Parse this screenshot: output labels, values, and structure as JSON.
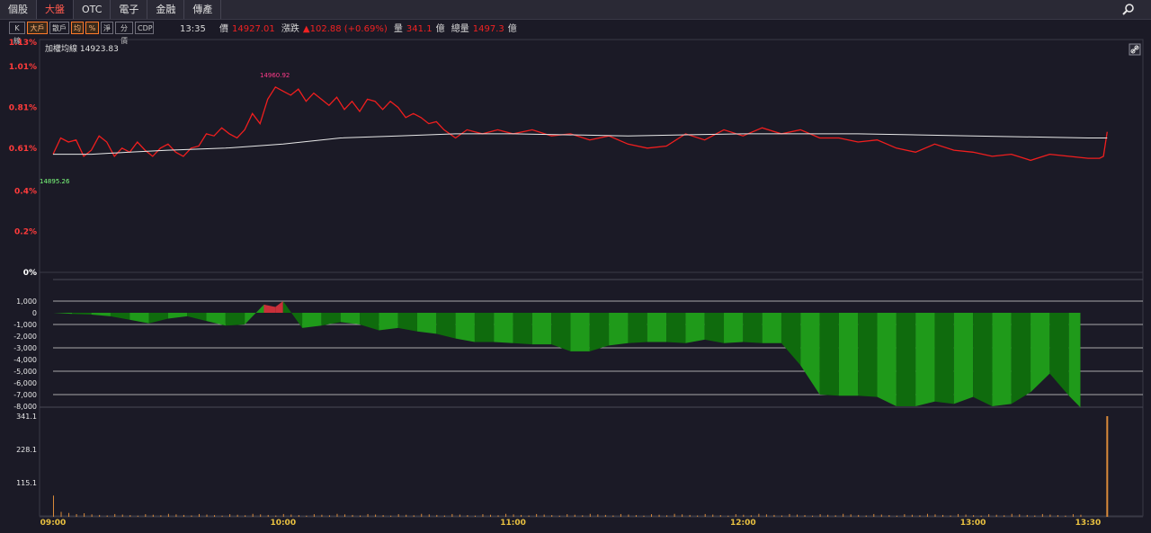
{
  "tabs": [
    "個股",
    "大盤",
    "OTC",
    "電子",
    "金融",
    "傳產"
  ],
  "active_tab": "大盤",
  "toolbar_buttons": [
    {
      "label": "K線",
      "on": false
    },
    {
      "label": "大戶",
      "on": true
    },
    {
      "label": "散戶",
      "on": false
    },
    {
      "label": "均",
      "on": true
    },
    {
      "label": "%",
      "on": true
    },
    {
      "label": "淨",
      "on": false
    },
    {
      "label": "分價",
      "on": false
    },
    {
      "label": "CDP",
      "on": false
    }
  ],
  "quote": {
    "time": "13:35",
    "price_label": "價",
    "price": "14927.01",
    "change_label": "漲跌",
    "change": "▲102.88 (+0.69%)",
    "volume_label": "量",
    "volume": "341.1",
    "volume_unit": "億",
    "total_label": "總量",
    "total": "1497.3",
    "total_unit": "億"
  },
  "colors": {
    "up": "#f01e1e",
    "avg": "#e8e8e8",
    "diff_light": "#1f9a1a",
    "diff_dark": "#0f6b0d",
    "volume": "#d98a3a",
    "grid": "#3a3946",
    "axis_label_up": "#ff3b3b",
    "time_label": "#e8c040"
  },
  "icons": [
    "search-icon",
    "link-icon"
  ],
  "chart_data": [
    {
      "type": "line",
      "legend_label": "加權均線 14923.83",
      "y_ticks": [
        "1.13%",
        "1.01%",
        "0.81%",
        "0.61%",
        "0.4%",
        "0.2%",
        "0%"
      ],
      "ylim_pct": [
        0,
        1.13
      ],
      "annotations": [
        {
          "text": "14960.92",
          "x": "09:57"
        },
        {
          "text": "14895.26",
          "x": "09:00"
        }
      ],
      "series": [
        {
          "role": "price",
          "points_pct": [
            [
              "09:00",
              0.58
            ],
            [
              "09:02",
              0.66
            ],
            [
              "09:04",
              0.64
            ],
            [
              "09:06",
              0.65
            ],
            [
              "09:08",
              0.57
            ],
            [
              "09:10",
              0.6
            ],
            [
              "09:12",
              0.67
            ],
            [
              "09:14",
              0.64
            ],
            [
              "09:16",
              0.57
            ],
            [
              "09:18",
              0.61
            ],
            [
              "09:20",
              0.59
            ],
            [
              "09:22",
              0.64
            ],
            [
              "09:24",
              0.6
            ],
            [
              "09:26",
              0.57
            ],
            [
              "09:28",
              0.61
            ],
            [
              "09:30",
              0.63
            ],
            [
              "09:32",
              0.59
            ],
            [
              "09:34",
              0.57
            ],
            [
              "09:36",
              0.61
            ],
            [
              "09:38",
              0.62
            ],
            [
              "09:40",
              0.68
            ],
            [
              "09:42",
              0.67
            ],
            [
              "09:44",
              0.71
            ],
            [
              "09:46",
              0.68
            ],
            [
              "09:48",
              0.66
            ],
            [
              "09:50",
              0.7
            ],
            [
              "09:52",
              0.78
            ],
            [
              "09:54",
              0.73
            ],
            [
              "09:56",
              0.85
            ],
            [
              "09:58",
              0.91
            ],
            [
              "10:00",
              0.89
            ],
            [
              "10:02",
              0.87
            ],
            [
              "10:04",
              0.9
            ],
            [
              "10:06",
              0.84
            ],
            [
              "10:08",
              0.88
            ],
            [
              "10:10",
              0.85
            ],
            [
              "10:12",
              0.82
            ],
            [
              "10:14",
              0.86
            ],
            [
              "10:16",
              0.8
            ],
            [
              "10:18",
              0.84
            ],
            [
              "10:20",
              0.79
            ],
            [
              "10:22",
              0.85
            ],
            [
              "10:24",
              0.84
            ],
            [
              "10:26",
              0.8
            ],
            [
              "10:28",
              0.84
            ],
            [
              "10:30",
              0.81
            ],
            [
              "10:32",
              0.76
            ],
            [
              "10:34",
              0.78
            ],
            [
              "10:36",
              0.76
            ],
            [
              "10:38",
              0.73
            ],
            [
              "10:40",
              0.74
            ],
            [
              "10:42",
              0.7
            ],
            [
              "10:45",
              0.66
            ],
            [
              "10:48",
              0.7
            ],
            [
              "10:52",
              0.68
            ],
            [
              "10:56",
              0.7
            ],
            [
              "11:00",
              0.68
            ],
            [
              "11:05",
              0.7
            ],
            [
              "11:10",
              0.67
            ],
            [
              "11:15",
              0.68
            ],
            [
              "11:20",
              0.65
            ],
            [
              "11:25",
              0.67
            ],
            [
              "11:30",
              0.63
            ],
            [
              "11:35",
              0.61
            ],
            [
              "11:40",
              0.62
            ],
            [
              "11:45",
              0.68
            ],
            [
              "11:50",
              0.65
            ],
            [
              "11:55",
              0.7
            ],
            [
              "12:00",
              0.67
            ],
            [
              "12:05",
              0.71
            ],
            [
              "12:10",
              0.68
            ],
            [
              "12:15",
              0.7
            ],
            [
              "12:20",
              0.66
            ],
            [
              "12:25",
              0.66
            ],
            [
              "12:30",
              0.64
            ],
            [
              "12:35",
              0.65
            ],
            [
              "12:40",
              0.61
            ],
            [
              "12:45",
              0.59
            ],
            [
              "12:50",
              0.63
            ],
            [
              "12:55",
              0.6
            ],
            [
              "13:00",
              0.59
            ],
            [
              "13:05",
              0.57
            ],
            [
              "13:10",
              0.58
            ],
            [
              "13:15",
              0.55
            ],
            [
              "13:20",
              0.58
            ],
            [
              "13:25",
              0.57
            ],
            [
              "13:30",
              0.56
            ],
            [
              "13:33",
              0.56
            ],
            [
              "13:34",
              0.57
            ],
            [
              "13:35",
              0.69
            ]
          ]
        },
        {
          "role": "average",
          "points_pct": [
            [
              "09:00",
              0.58
            ],
            [
              "09:10",
              0.58
            ],
            [
              "09:20",
              0.59
            ],
            [
              "09:30",
              0.6
            ],
            [
              "09:45",
              0.61
            ],
            [
              "10:00",
              0.63
            ],
            [
              "10:15",
              0.66
            ],
            [
              "10:30",
              0.67
            ],
            [
              "10:45",
              0.68
            ],
            [
              "11:00",
              0.68
            ],
            [
              "11:30",
              0.67
            ],
            [
              "12:00",
              0.68
            ],
            [
              "12:30",
              0.68
            ],
            [
              "13:00",
              0.67
            ],
            [
              "13:30",
              0.66
            ],
            [
              "13:35",
              0.66
            ]
          ]
        }
      ],
      "time_ticks": [
        "09:00",
        "10:00",
        "11:00",
        "12:00",
        "13:00",
        "13:30"
      ]
    },
    {
      "type": "area",
      "y_ticks": [
        "1,000",
        "0",
        "-1,000",
        "-2,000",
        "-3,000",
        "-4,000",
        "-5,000",
        "-6,000",
        "-7,000",
        "-8,000"
      ],
      "ylim": [
        -8500,
        1200
      ],
      "points": [
        [
          "09:00",
          0
        ],
        [
          "09:05",
          -100
        ],
        [
          "09:10",
          -150
        ],
        [
          "09:15",
          -300
        ],
        [
          "09:20",
          -600
        ],
        [
          "09:25",
          -900
        ],
        [
          "09:30",
          -500
        ],
        [
          "09:35",
          -300
        ],
        [
          "09:40",
          -700
        ],
        [
          "09:45",
          -1100
        ],
        [
          "09:50",
          -1000
        ],
        [
          "09:55",
          700
        ],
        [
          "09:58",
          500
        ],
        [
          "10:00",
          1000
        ],
        [
          "10:05",
          -1300
        ],
        [
          "10:10",
          -1100
        ],
        [
          "10:15",
          -800
        ],
        [
          "10:20",
          -1000
        ],
        [
          "10:25",
          -1500
        ],
        [
          "10:30",
          -1300
        ],
        [
          "10:35",
          -1600
        ],
        [
          "10:40",
          -1800
        ],
        [
          "10:45",
          -2200
        ],
        [
          "10:50",
          -2500
        ],
        [
          "10:55",
          -2500
        ],
        [
          "11:00",
          -2600
        ],
        [
          "11:05",
          -2700
        ],
        [
          "11:10",
          -2700
        ],
        [
          "11:15",
          -3300
        ],
        [
          "11:20",
          -3300
        ],
        [
          "11:25",
          -2800
        ],
        [
          "11:30",
          -2600
        ],
        [
          "11:35",
          -2500
        ],
        [
          "11:40",
          -2500
        ],
        [
          "11:45",
          -2600
        ],
        [
          "11:50",
          -2300
        ],
        [
          "11:55",
          -2600
        ],
        [
          "12:00",
          -2500
        ],
        [
          "12:05",
          -2600
        ],
        [
          "12:10",
          -2600
        ],
        [
          "12:15",
          -4500
        ],
        [
          "12:20",
          -7000
        ],
        [
          "12:25",
          -7100
        ],
        [
          "12:30",
          -7100
        ],
        [
          "12:35",
          -7200
        ],
        [
          "12:40",
          -8000
        ],
        [
          "12:45",
          -8000
        ],
        [
          "12:50",
          -7600
        ],
        [
          "12:55",
          -7800
        ],
        [
          "13:00",
          -7200
        ],
        [
          "13:05",
          -8000
        ],
        [
          "13:10",
          -7800
        ],
        [
          "13:15",
          -6800
        ],
        [
          "13:20",
          -5200
        ],
        [
          "13:25",
          -7100
        ],
        [
          "13:28",
          -8100
        ]
      ]
    },
    {
      "type": "bar",
      "y_ticks": [
        "341.1",
        "228.1",
        "115.1"
      ],
      "ylim": [
        0,
        341.1
      ],
      "first_bar": 72,
      "last_bar": 341.1
    }
  ]
}
